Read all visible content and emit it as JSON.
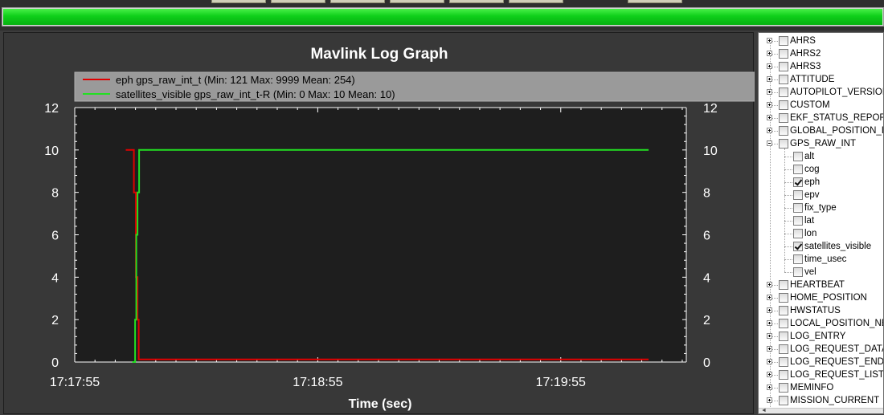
{
  "progress": {
    "value": 1.0,
    "color": "#0fcf1a"
  },
  "chart_data": {
    "type": "line",
    "title": "Mavlink Log Graph",
    "xlabel": "Time (sec)",
    "ylabel": "",
    "x_ticks": [
      "17:17:55",
      "17:18:55",
      "17:19:55"
    ],
    "x_tick_positions": [
      0,
      60,
      120
    ],
    "xlim": [
      0,
      151
    ],
    "ylim": [
      0,
      12
    ],
    "y_ticks": [
      "0",
      "2",
      "4",
      "6",
      "8",
      "10",
      "12"
    ],
    "y2_ticks": [
      "0",
      "2",
      "4",
      "6",
      "8",
      "10",
      "12"
    ],
    "background": "#1e1e1e",
    "axis_color": "#ffffff",
    "grid": false,
    "legend_placement": "top",
    "series": [
      {
        "name": "eph gps_raw_int_t (Min: 121 Max: 9999 Mean: 254)",
        "color": "#e00000",
        "points": [
          [
            12.6,
            10
          ],
          [
            14.6,
            10
          ],
          [
            14.6,
            8
          ],
          [
            15.1,
            8
          ],
          [
            15.1,
            4
          ],
          [
            15.5,
            4
          ],
          [
            15.5,
            2
          ],
          [
            15.8,
            2
          ],
          [
            15.8,
            0.12
          ],
          [
            141.7,
            0.12
          ]
        ]
      },
      {
        "name": "satellites_visible gps_raw_int_t-R (Min: 0 Max: 10 Mean: 10)",
        "color": "#22e022",
        "points": [
          [
            14.2,
            0
          ],
          [
            14.9,
            0
          ],
          [
            14.9,
            2
          ],
          [
            15.2,
            2
          ],
          [
            15.2,
            6
          ],
          [
            15.5,
            6
          ],
          [
            15.5,
            8
          ],
          [
            15.9,
            8
          ],
          [
            15.9,
            10
          ],
          [
            141.7,
            10
          ]
        ]
      }
    ]
  },
  "tree": {
    "items": [
      {
        "label": "AHRS",
        "level": 0,
        "expander": "plus",
        "checked": false
      },
      {
        "label": "AHRS2",
        "level": 0,
        "expander": "plus",
        "checked": false
      },
      {
        "label": "AHRS3",
        "level": 0,
        "expander": "plus",
        "checked": false
      },
      {
        "label": "ATTITUDE",
        "level": 0,
        "expander": "plus",
        "checked": false
      },
      {
        "label": "AUTOPILOT_VERSION",
        "level": 0,
        "expander": "plus",
        "checked": false
      },
      {
        "label": "CUSTOM",
        "level": 0,
        "expander": "plus",
        "checked": false
      },
      {
        "label": "EKF_STATUS_REPORT",
        "level": 0,
        "expander": "plus",
        "checked": false
      },
      {
        "label": "GLOBAL_POSITION_INT",
        "level": 0,
        "expander": "plus",
        "checked": false
      },
      {
        "label": "GPS_RAW_INT",
        "level": 0,
        "expander": "minus",
        "checked": false
      },
      {
        "label": "alt",
        "level": 1,
        "checked": false
      },
      {
        "label": "cog",
        "level": 1,
        "checked": false
      },
      {
        "label": "eph",
        "level": 1,
        "checked": true
      },
      {
        "label": "epv",
        "level": 1,
        "checked": false
      },
      {
        "label": "fix_type",
        "level": 1,
        "checked": false
      },
      {
        "label": "lat",
        "level": 1,
        "checked": false
      },
      {
        "label": "lon",
        "level": 1,
        "checked": false
      },
      {
        "label": "satellites_visible",
        "level": 1,
        "checked": true
      },
      {
        "label": "time_usec",
        "level": 1,
        "checked": false
      },
      {
        "label": "vel",
        "level": 1,
        "checked": false
      },
      {
        "label": "HEARTBEAT",
        "level": 0,
        "expander": "plus",
        "checked": false
      },
      {
        "label": "HOME_POSITION",
        "level": 0,
        "expander": "plus",
        "checked": false
      },
      {
        "label": "HWSTATUS",
        "level": 0,
        "expander": "plus",
        "checked": false
      },
      {
        "label": "LOCAL_POSITION_NED",
        "level": 0,
        "expander": "plus",
        "checked": false
      },
      {
        "label": "LOG_ENTRY",
        "level": 0,
        "expander": "plus",
        "checked": false
      },
      {
        "label": "LOG_REQUEST_DATA",
        "level": 0,
        "expander": "plus",
        "checked": false
      },
      {
        "label": "LOG_REQUEST_END",
        "level": 0,
        "expander": "plus",
        "checked": false
      },
      {
        "label": "LOG_REQUEST_LIST",
        "level": 0,
        "expander": "plus",
        "checked": false
      },
      {
        "label": "MEMINFO",
        "level": 0,
        "expander": "plus",
        "checked": false
      },
      {
        "label": "MISSION_CURRENT",
        "level": 0,
        "expander": "plus",
        "checked": false
      }
    ]
  }
}
